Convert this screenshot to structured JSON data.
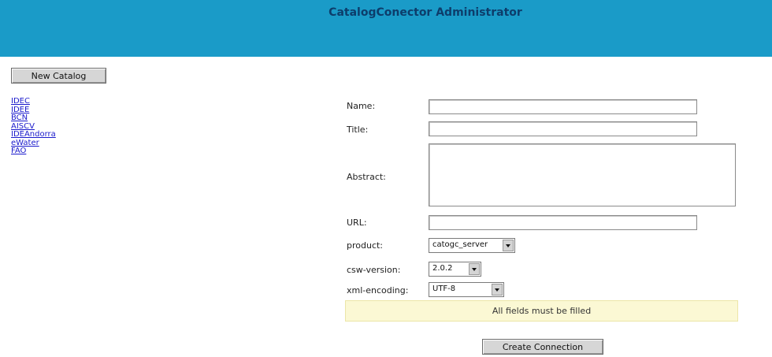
{
  "header": {
    "title": "CatalogConector Administrator"
  },
  "sidebar": {
    "new_catalog_label": "New Catalog",
    "catalogs": [
      "IDEC",
      "IDEE",
      "BCN",
      "AISCV",
      "IDEAndorra",
      "eWater",
      "FAO"
    ]
  },
  "form": {
    "name_label": "Name:",
    "name_value": "",
    "title_label": "Title:",
    "title_value": "",
    "abstract_label": "Abstract:",
    "abstract_value": "",
    "url_label": "URL:",
    "url_value": "",
    "product_label": "product:",
    "product_value": "catogc_server",
    "csw_version_label": "csw-version:",
    "csw_version_value": "2.0.2",
    "xml_encoding_label": "xml-encoding:",
    "xml_encoding_value": "UTF-8",
    "notice": "All fields must be filled",
    "submit_label": "Create Connection"
  },
  "colors": {
    "header_bg": "#1a9bc8",
    "notice_bg": "#fbf8d4",
    "link": "#1a1acc"
  },
  "icons": {
    "select_arrow": "chevron-down-icon"
  }
}
